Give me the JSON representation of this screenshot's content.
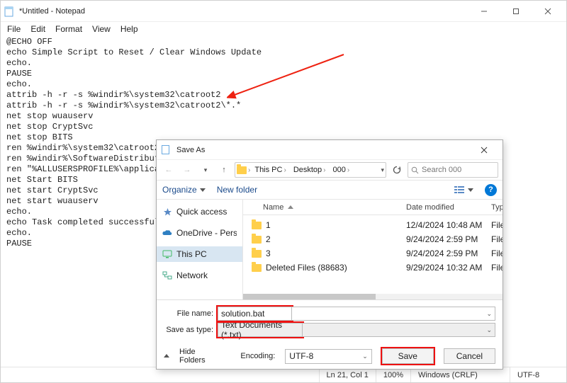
{
  "notepad": {
    "title": "*Untitled - Notepad",
    "menus": {
      "file": "File",
      "edit": "Edit",
      "format": "Format",
      "view": "View",
      "help": "Help"
    },
    "content": "@ECHO OFF\necho Simple Script to Reset / Clear Windows Update\necho.\nPAUSE\necho.\nattrib -h -r -s %windir%\\system32\\catroot2\nattrib -h -r -s %windir%\\system32\\catroot2\\*.*\nnet stop wuauserv\nnet stop CryptSvc\nnet stop BITS\nren %windir%\\system32\\catroot2 catroot2.old\nren %windir%\\SoftwareDistribution sold.old\nren \"%ALLUSERSPROFILE%\\application data\\Microsoft\\Network\\downloader\" downloader.old\nnet Start BITS\nnet start CryptSvc\nnet start wuauserv\necho.\necho Task completed successfully...\necho.\nPAUSE",
    "status": {
      "pos": "Ln 21, Col 1",
      "zoom": "100%",
      "eol": "Windows (CRLF)",
      "enc": "UTF-8"
    }
  },
  "dialog": {
    "title": "Save As",
    "breadcrumb": {
      "pc": "This PC",
      "desktop": "Desktop",
      "folder": "000"
    },
    "search_placeholder": "Search 000",
    "toolbar": {
      "organize": "Organize",
      "newfolder": "New folder"
    },
    "nav": {
      "quick": "Quick access",
      "onedrive": "OneDrive - Personal",
      "thispc": "This PC",
      "network": "Network"
    },
    "cols": {
      "name": "Name",
      "date": "Date modified",
      "type": "Type"
    },
    "rows": [
      {
        "name": "1",
        "date": "12/4/2024 10:48 AM",
        "type": "File"
      },
      {
        "name": "2",
        "date": "9/24/2024 2:59 PM",
        "type": "File"
      },
      {
        "name": "3",
        "date": "9/24/2024 2:59 PM",
        "type": "File"
      },
      {
        "name": "Deleted Files (88683)",
        "date": "9/29/2024 10:32 AM",
        "type": "File"
      }
    ],
    "labels": {
      "filename": "File name:",
      "saveas": "Save as type:",
      "encoding": "Encoding:",
      "hide": "Hide Folders"
    },
    "values": {
      "filename": "solution.bat",
      "saveas": "Text Documents (*.txt)",
      "encoding": "UTF-8"
    },
    "buttons": {
      "save": "Save",
      "cancel": "Cancel"
    }
  }
}
